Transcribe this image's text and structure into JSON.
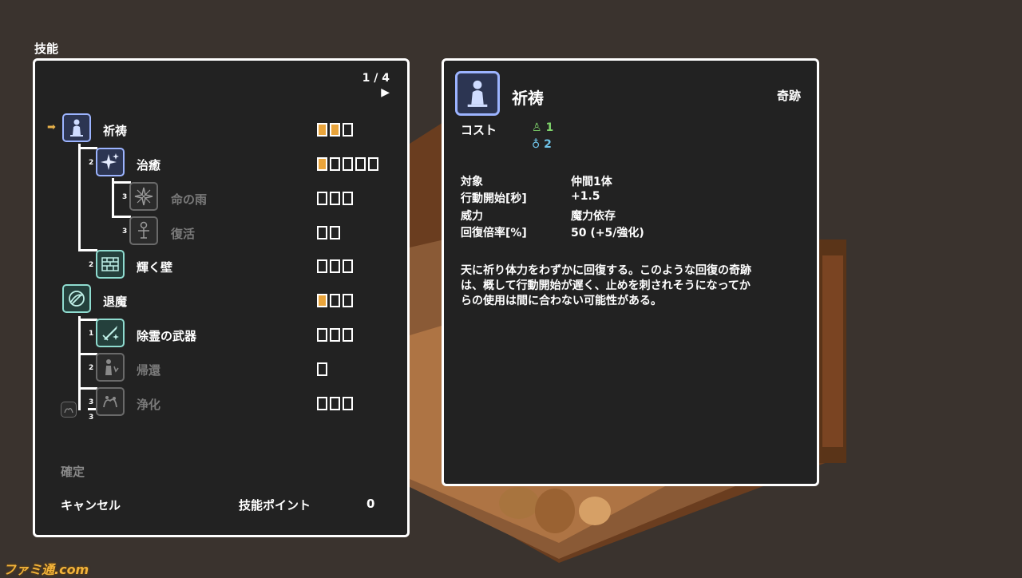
{
  "screen_title": "技能",
  "skill_panel": {
    "page_indicator": "1 / 4",
    "page_next_icon": "▶",
    "cursor_icon": "➡",
    "skills": [
      {
        "name": "祈祷",
        "icon": "prayer-icon",
        "level": "",
        "gauge_total": 3,
        "gauge_filled": 2,
        "dim": false,
        "color": "blue"
      },
      {
        "name": "治癒",
        "icon": "sparkle-icon",
        "level": "2",
        "gauge_total": 5,
        "gauge_filled": 1,
        "dim": false,
        "color": "blue"
      },
      {
        "name": "命の雨",
        "icon": "starburst-icon",
        "level": "3",
        "gauge_total": 3,
        "gauge_filled": 0,
        "dim": true,
        "color": "grey"
      },
      {
        "name": "復活",
        "icon": "revive-icon",
        "level": "3",
        "gauge_total": 2,
        "gauge_filled": 0,
        "dim": true,
        "color": "grey"
      },
      {
        "name": "輝く壁",
        "icon": "wall-icon",
        "level": "2",
        "gauge_total": 3,
        "gauge_filled": 0,
        "dim": false,
        "color": "teal"
      },
      {
        "name": "退魔",
        "icon": "exorcism-icon",
        "level": "",
        "gauge_total": 3,
        "gauge_filled": 1,
        "dim": false,
        "color": "teal"
      },
      {
        "name": "除霊の武器",
        "icon": "holy-sword-icon",
        "level": "1",
        "gauge_total": 3,
        "gauge_filled": 0,
        "dim": false,
        "color": "teal"
      },
      {
        "name": "帰還",
        "icon": "return-icon",
        "level": "2",
        "gauge_total": 1,
        "gauge_filled": 0,
        "dim": true,
        "color": "grey"
      },
      {
        "name": "浄化",
        "icon": "purify-icon",
        "level": "3",
        "gauge_total": 3,
        "gauge_filled": 0,
        "dim": true,
        "color": "grey"
      }
    ],
    "extra_level": "3",
    "confirm_label": "確定",
    "cancel_label": "キャンセル",
    "points_label": "技能ポイント",
    "points_value": "0"
  },
  "detail": {
    "title": "祈祷",
    "category": "奇跡",
    "cost_label": "コスト",
    "cost_stamina": "1",
    "cost_mana": "2",
    "stats": [
      {
        "label": "対象",
        "value": "仲間1体"
      },
      {
        "label": "行動開始[秒]",
        "value": "+1.5"
      },
      {
        "label": "威力",
        "value": "魔力依存"
      },
      {
        "label": "回復倍率[%]",
        "value": "50 (+5/強化)"
      }
    ],
    "description_lines": [
      "天に祈り体力をわずかに回復する。このような回復の奇跡",
      "は、概して行動開始が遅く、止めを刺されそうになってか",
      "らの使用は間に合わない可能性がある。"
    ]
  },
  "watermark": "ファミ通.com",
  "colors": {
    "accent": "#e9a43b",
    "panel": "#222222",
    "icon_blue": "#9cb4ff",
    "icon_teal": "#8fdcd0"
  }
}
